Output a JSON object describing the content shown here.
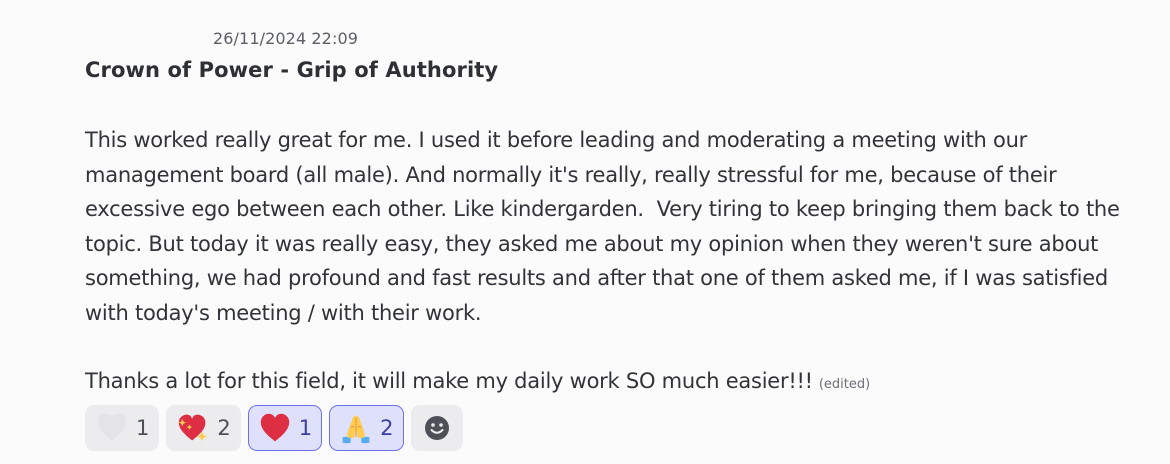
{
  "message": {
    "timestamp": "26/11/2024 22:09",
    "title": "Crown of Power - Grip of Authority",
    "body": "This worked really great for me. I used it before leading and moderating a meeting with our management board (all male). And normally it's really, really stressful for me, because of their excessive ego between each other. Like kindergarden.  Very tiring to keep bringing them back to the topic. But today it was really easy, they asked me about my opinion when they weren't sure about something, we had profound and fast results and after that one of them asked me, if I was satisfied with today's meeting / with their work.",
    "closing": "Thanks a lot for this field, it will make my daily work SO much easier!!!",
    "edited_label": "(edited)"
  },
  "reactions": [
    {
      "emoji": "white-heart-icon",
      "count": "1",
      "reacted_by_me": false
    },
    {
      "emoji": "sparkling-heart-icon",
      "count": "2",
      "reacted_by_me": false
    },
    {
      "emoji": "red-heart-icon",
      "count": "1",
      "reacted_by_me": true
    },
    {
      "emoji": "folded-hands-icon",
      "count": "2",
      "reacted_by_me": true
    }
  ],
  "add_reaction": {
    "icon": "add-reaction-smiley-icon"
  },
  "colors": {
    "background": "#fbfbfb",
    "reaction_bg": "#ececee",
    "reaction_me_bg": "#dfe1fb",
    "reaction_me_border": "#6b73e6"
  }
}
